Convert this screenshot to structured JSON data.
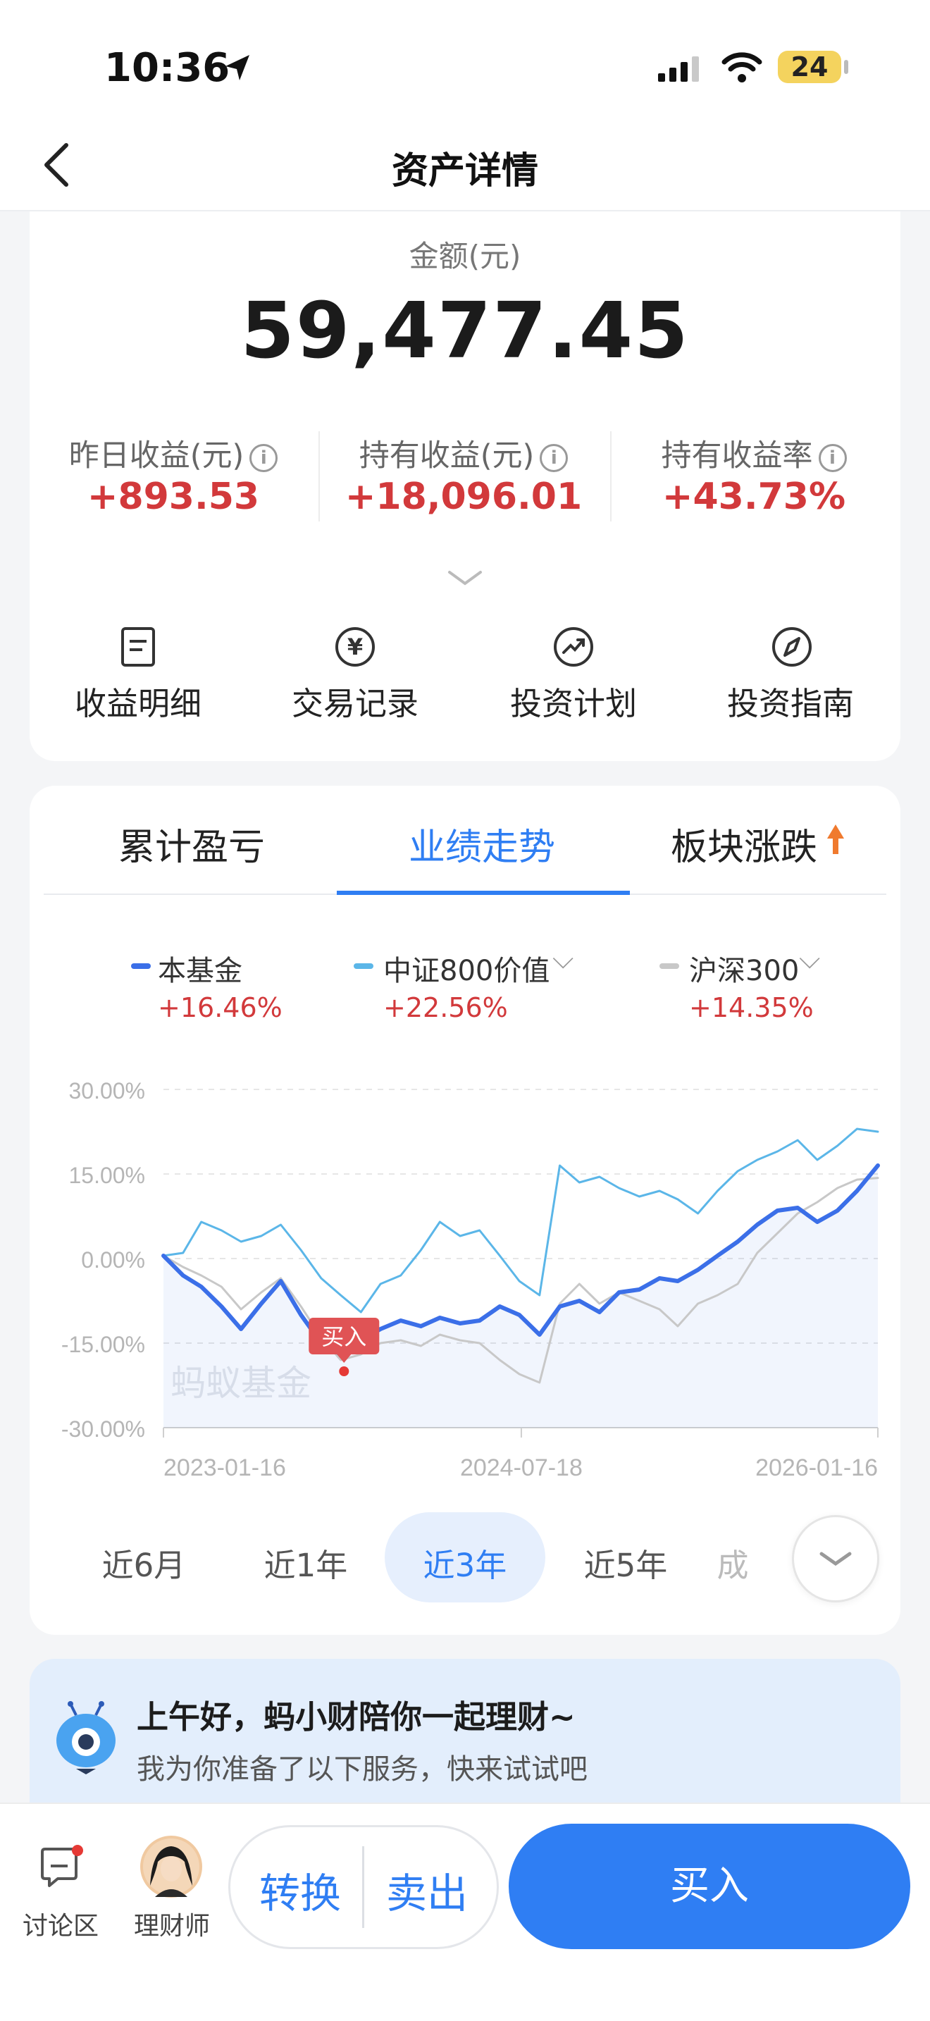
{
  "status": {
    "time": "10:36",
    "battery": "24"
  },
  "nav": {
    "title": "资产详情"
  },
  "summary": {
    "amount_label": "金额(元)",
    "amount": "59,477.45",
    "stats": [
      {
        "label": "昨日收益(元)",
        "value": "+893.53"
      },
      {
        "label": "持有收益(元)",
        "value": "+18,096.01"
      },
      {
        "label": "持有收益率",
        "value": "+43.73%"
      }
    ],
    "actions": [
      {
        "label": "收益明细",
        "icon": "document-icon"
      },
      {
        "label": "交易记录",
        "icon": "yen-icon"
      },
      {
        "label": "投资计划",
        "icon": "trend-icon"
      },
      {
        "label": "投资指南",
        "icon": "compass-icon"
      }
    ]
  },
  "tabs": [
    {
      "label": "累计盈亏"
    },
    {
      "label": "业绩走势",
      "active": true
    },
    {
      "label": "板块涨跌"
    }
  ],
  "legend": [
    {
      "name": "本基金",
      "pct": "+16.46%",
      "color": "#3b6fe8"
    },
    {
      "name": "中证800价值",
      "pct": "+22.56%",
      "color": "#5bb6e8"
    },
    {
      "name": "沪深300",
      "pct": "+14.35%",
      "color": "#c8c8c8"
    }
  ],
  "chart_data": {
    "type": "line",
    "y_ticks": [
      "30.00%",
      "15.00%",
      "0.00%",
      "-15.00%",
      "-30.00%"
    ],
    "x_ticks": [
      "2023-01-16",
      "2024-07-18",
      "2026-01-16"
    ],
    "ylim": [
      -30,
      30
    ],
    "watermark": "蚂蚁基金",
    "buy_marker": "买入",
    "buy_date": "2023-10-20",
    "series": [
      {
        "name": "本基金",
        "color": "#3b6fe8",
        "points": [
          [
            "2023-01-16",
            0.5
          ],
          [
            "2023-02-15",
            -3.0
          ],
          [
            "2023-03-15",
            -5.0
          ],
          [
            "2023-04-15",
            -8.5
          ],
          [
            "2023-05-15",
            -12.5
          ],
          [
            "2023-06-15",
            -8.0
          ],
          [
            "2023-07-15",
            -4.0
          ],
          [
            "2023-08-15",
            -10.0
          ],
          [
            "2023-09-15",
            -15.0
          ],
          [
            "2023-10-15",
            -17.0
          ],
          [
            "2023-10-20",
            -17.5
          ],
          [
            "2023-11-15",
            -14.5
          ],
          [
            "2023-12-15",
            -12.5
          ],
          [
            "2024-01-15",
            -11.0
          ],
          [
            "2024-02-15",
            -12.0
          ],
          [
            "2024-03-15",
            -10.5
          ],
          [
            "2024-04-15",
            -11.5
          ],
          [
            "2024-05-15",
            -11.0
          ],
          [
            "2024-06-15",
            -8.5
          ],
          [
            "2024-07-15",
            -10.0
          ],
          [
            "2024-08-15",
            -13.5
          ],
          [
            "2024-09-15",
            -8.5
          ],
          [
            "2024-10-15",
            -7.5
          ],
          [
            "2024-11-15",
            -9.5
          ],
          [
            "2024-12-15",
            -6.0
          ],
          [
            "2025-01-15",
            -5.5
          ],
          [
            "2025-02-15",
            -3.5
          ],
          [
            "2025-03-15",
            -4.0
          ],
          [
            "2025-04-15",
            -2.0
          ],
          [
            "2025-05-15",
            0.5
          ],
          [
            "2025-06-15",
            3.0
          ],
          [
            "2025-07-15",
            6.0
          ],
          [
            "2025-08-15",
            8.5
          ],
          [
            "2025-09-15",
            9.0
          ],
          [
            "2025-10-15",
            6.5
          ],
          [
            "2025-11-15",
            8.5
          ],
          [
            "2025-12-15",
            12.0
          ],
          [
            "2026-01-16",
            16.5
          ]
        ]
      },
      {
        "name": "中证800价值",
        "color": "#5bb6e8",
        "points": [
          [
            "2023-01-16",
            0.5
          ],
          [
            "2023-02-15",
            1.0
          ],
          [
            "2023-03-15",
            6.5
          ],
          [
            "2023-04-15",
            5.0
          ],
          [
            "2023-05-15",
            3.0
          ],
          [
            "2023-06-15",
            4.0
          ],
          [
            "2023-07-15",
            6.0
          ],
          [
            "2023-08-15",
            1.5
          ],
          [
            "2023-09-15",
            -3.5
          ],
          [
            "2023-10-15",
            -6.5
          ],
          [
            "2023-11-15",
            -9.5
          ],
          [
            "2023-12-15",
            -4.5
          ],
          [
            "2024-01-15",
            -3.0
          ],
          [
            "2024-02-15",
            1.5
          ],
          [
            "2024-03-15",
            6.5
          ],
          [
            "2024-04-15",
            4.0
          ],
          [
            "2024-05-15",
            5.0
          ],
          [
            "2024-06-15",
            0.5
          ],
          [
            "2024-07-15",
            -4.0
          ],
          [
            "2024-08-15",
            -6.5
          ],
          [
            "2024-09-15",
            16.5
          ],
          [
            "2024-10-15",
            13.5
          ],
          [
            "2024-11-15",
            14.5
          ],
          [
            "2024-12-15",
            12.5
          ],
          [
            "2025-01-15",
            11.0
          ],
          [
            "2025-02-15",
            12.0
          ],
          [
            "2025-03-15",
            10.5
          ],
          [
            "2025-04-15",
            8.0
          ],
          [
            "2025-05-15",
            12.0
          ],
          [
            "2025-06-15",
            15.5
          ],
          [
            "2025-07-15",
            17.5
          ],
          [
            "2025-08-15",
            19.0
          ],
          [
            "2025-09-15",
            21.0
          ],
          [
            "2025-10-15",
            17.5
          ],
          [
            "2025-11-15",
            20.0
          ],
          [
            "2025-12-15",
            23.0
          ],
          [
            "2026-01-16",
            22.5
          ]
        ]
      },
      {
        "name": "沪深300",
        "color": "#c8c8c8",
        "points": [
          [
            "2023-01-16",
            0.5
          ],
          [
            "2023-02-15",
            -1.5
          ],
          [
            "2023-03-15",
            -3.0
          ],
          [
            "2023-04-15",
            -5.0
          ],
          [
            "2023-05-15",
            -9.0
          ],
          [
            "2023-06-15",
            -6.0
          ],
          [
            "2023-07-15",
            -3.5
          ],
          [
            "2023-08-15",
            -8.5
          ],
          [
            "2023-09-15",
            -14.0
          ],
          [
            "2023-10-15",
            -18.0
          ],
          [
            "2023-11-15",
            -17.0
          ],
          [
            "2023-12-15",
            -15.0
          ],
          [
            "2024-01-15",
            -14.5
          ],
          [
            "2024-02-15",
            -15.5
          ],
          [
            "2024-03-15",
            -13.5
          ],
          [
            "2024-04-15",
            -14.5
          ],
          [
            "2024-05-15",
            -15.0
          ],
          [
            "2024-06-15",
            -18.0
          ],
          [
            "2024-07-15",
            -20.5
          ],
          [
            "2024-08-15",
            -22.0
          ],
          [
            "2024-09-15",
            -8.0
          ],
          [
            "2024-10-15",
            -4.5
          ],
          [
            "2024-11-15",
            -8.0
          ],
          [
            "2024-12-15",
            -6.0
          ],
          [
            "2025-01-15",
            -7.5
          ],
          [
            "2025-02-15",
            -9.0
          ],
          [
            "2025-03-15",
            -12.0
          ],
          [
            "2025-04-15",
            -8.0
          ],
          [
            "2025-05-15",
            -6.5
          ],
          [
            "2025-06-15",
            -4.5
          ],
          [
            "2025-07-15",
            1.0
          ],
          [
            "2025-08-15",
            4.5
          ],
          [
            "2025-09-15",
            8.0
          ],
          [
            "2025-10-15",
            10.0
          ],
          [
            "2025-11-15",
            12.5
          ],
          [
            "2025-12-15",
            14.0
          ],
          [
            "2026-01-16",
            14.3
          ]
        ]
      }
    ]
  },
  "ranges": [
    {
      "label": "近6月"
    },
    {
      "label": "近1年"
    },
    {
      "label": "近3年",
      "active": true
    },
    {
      "label": "近5年"
    },
    {
      "label": "成"
    }
  ],
  "assistant": {
    "greeting": "上午好，蚂小财陪你一起理财~",
    "sub": "我为你准备了以下服务，快来试试吧"
  },
  "bottom": {
    "discuss_label": "讨论区",
    "advisor_label": "理财师",
    "convert_label": "转换",
    "sell_label": "卖出",
    "buy_label": "买入"
  }
}
